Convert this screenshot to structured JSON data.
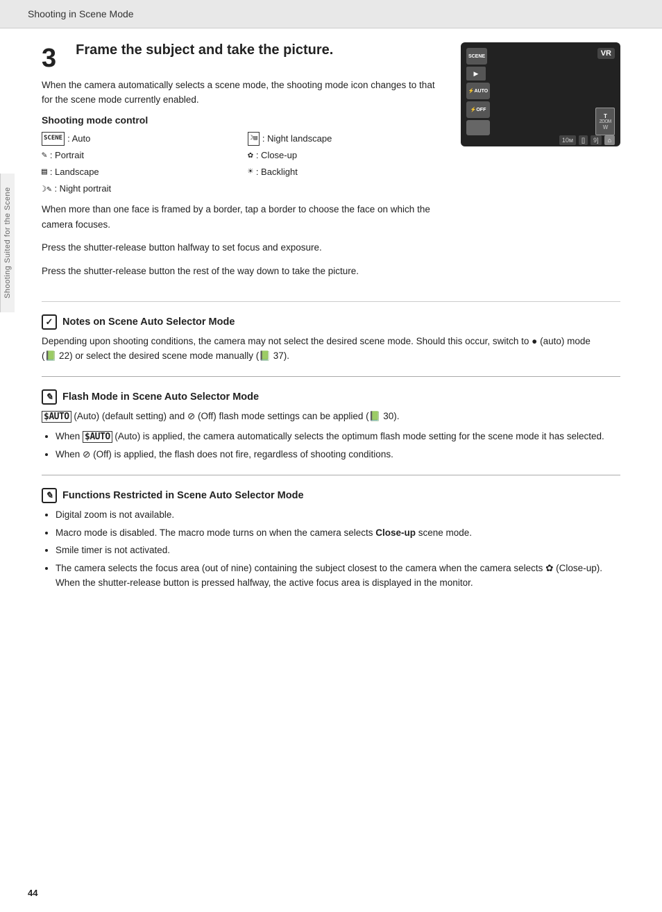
{
  "header": {
    "title": "Shooting in Scene Mode"
  },
  "step": {
    "number": "3",
    "title": "Frame the subject and take the picture.",
    "description": "When the camera automatically selects a scene mode, the shooting mode icon changes to that for the scene mode currently enabled.",
    "shooting_mode_label": "Shooting mode control",
    "modes_left": [
      {
        "icon": "SCENE",
        "label": ": Auto"
      },
      {
        "icon": "✎",
        "label": ": Portrait"
      },
      {
        "icon": "▤",
        "label": ": Landscape"
      },
      {
        "icon": "☾✎",
        "label": ": Night portrait"
      }
    ],
    "modes_right": [
      {
        "icon": "☾▤",
        "label": ": Night landscape"
      },
      {
        "icon": "✿✎",
        "label": ": Close-up"
      },
      {
        "icon": "☀✎",
        "label": ": Backlight"
      }
    ],
    "para1": "When more than one face is framed by a border, tap a border to choose the face on which the camera focuses.",
    "para2": "Press the shutter-release button halfway to set focus and exposure.",
    "para3": "Press the shutter-release button the rest of the way down to take the picture."
  },
  "notes": {
    "scene_auto_title": "Notes on Scene Auto Selector Mode",
    "scene_auto_body": "Depending upon shooting conditions, the camera may not select the desired scene mode. Should this occur, switch to  (auto) mode (  22) or select the desired scene mode manually (  37).",
    "flash_title": "Flash Mode in Scene Auto Selector Mode",
    "flash_body": " (Auto) (default setting) and ⊙ (Off) flash mode settings can be applied (  30).",
    "flash_bullet1": "When  (Auto) is applied, the camera automatically selects the optimum flash mode setting for the scene mode it has selected.",
    "flash_bullet2": "When ⊙ (Off) is applied, the flash does not fire, regardless of shooting conditions.",
    "functions_title": "Functions Restricted in Scene Auto Selector Mode",
    "functions_bullets": [
      "Digital zoom is not available.",
      "Macro mode is disabled. The macro mode turns on when the camera selects Close-up scene mode.",
      "Smile timer is not activated.",
      "The camera selects the focus area (out of nine) containing the subject closest to the camera when the camera selects  (Close-up). When the shutter-release button is pressed halfway, the active focus area is displayed in the monitor."
    ]
  },
  "sidebar": {
    "label": "Shooting Suited for the Scene"
  },
  "page_number": "44",
  "camera": {
    "vr": "VR",
    "scene_icon": "SCENE",
    "play": "▶",
    "flash": "⚡AUTO",
    "flash_off": "⚡OFF",
    "bottom_icons": [
      "10м",
      "[]",
      "9]"
    ],
    "home": "🏠"
  }
}
